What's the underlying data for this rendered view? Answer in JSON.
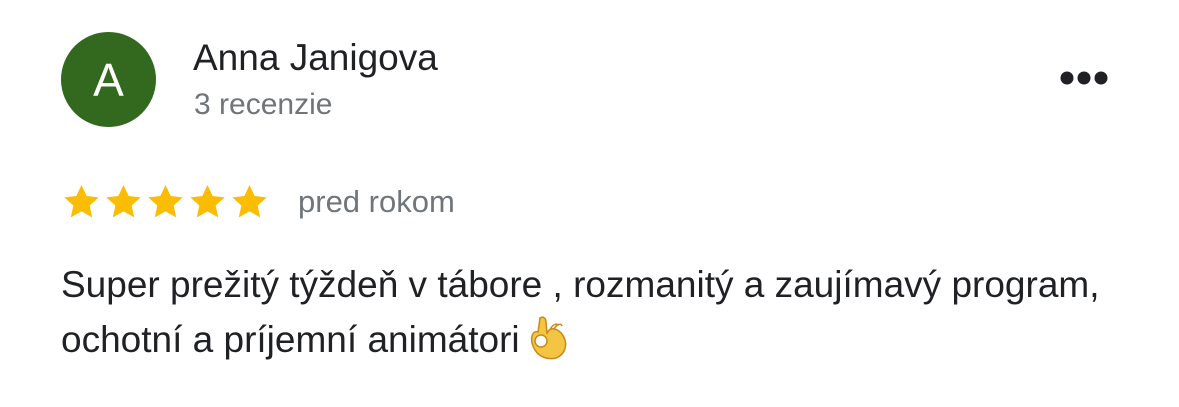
{
  "review": {
    "avatar_initial": "A",
    "avatar_color": "#33691e",
    "author_name": "Anna Janigova",
    "reviews_count": "3 recenzie",
    "rating": 5,
    "rating_max": 5,
    "star_color": "#fbbc04",
    "date": "pred rokom",
    "text": "Super prežitý týždeň v tábore , rozmanitý a zaujímavý program, ochotní a príjemní animátori",
    "emoji": "ok-hand-emoji",
    "more_icon": "more-horizontal-icon"
  }
}
